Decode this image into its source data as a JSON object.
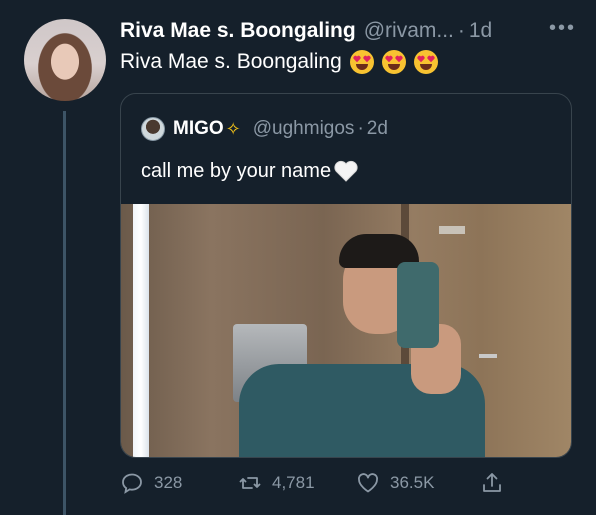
{
  "tweet": {
    "display_name": "Riva Mae s. Boongaling",
    "handle": "@rivam...",
    "separator": "·",
    "time": "1d",
    "more_label": "•••",
    "text": "Riva Mae s. Boongaling",
    "emojis": [
      "heart-eyes",
      "heart-eyes",
      "heart-eyes"
    ]
  },
  "quoted": {
    "display_name": "MIGO",
    "name_emoji": "dizzy",
    "handle": "@ughmigos",
    "separator": "·",
    "time": "2d",
    "text": "call me by your name",
    "text_emoji": "white-heart"
  },
  "actions": {
    "replies": "328",
    "retweets": "4,781",
    "likes": "36.5K"
  },
  "colors": {
    "background": "#15202b",
    "muted": "#8b98a5",
    "border": "#38444d"
  }
}
